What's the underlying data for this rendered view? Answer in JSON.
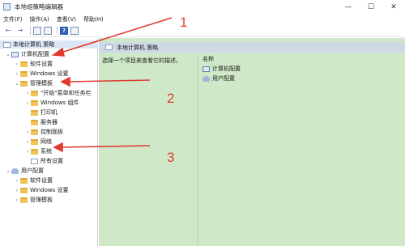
{
  "window": {
    "title": "本地组策略编辑器",
    "controls": [
      "—",
      "☐",
      "✕"
    ]
  },
  "menu": [
    "文件(F)",
    "操作(A)",
    "查看(V)",
    "帮助(H)"
  ],
  "toolbar": {
    "back": "←",
    "forward": "→",
    "help": "?"
  },
  "tree": {
    "root": "本地计算机 策略",
    "computer_config": "计算机配置",
    "software_settings": "软件设置",
    "windows_settings": "Windows 设置",
    "admin_templates": "管理模板",
    "admin_children": [
      "\"开始\"菜单和任务栏",
      "Windows 组件",
      "打印机",
      "服务器",
      "控制面板",
      "网络",
      "系统",
      "所有设置"
    ],
    "user_config": "用户配置",
    "user_children": [
      "软件设置",
      "Windows 设置",
      "管理模板"
    ]
  },
  "right_pane": {
    "header": "本地计算机 策略",
    "description": "选择一个项目来查看它的描述。",
    "column_name": "名称",
    "items": [
      "计算机配置",
      "用户配置"
    ]
  },
  "annotations": {
    "labels": [
      "1",
      "2",
      "3"
    ],
    "color": "#e03b2f"
  },
  "colors": {
    "content_bg": "#cfe8c8",
    "header_bg": "#cfd9e6",
    "selection": "#dbe7f5"
  }
}
